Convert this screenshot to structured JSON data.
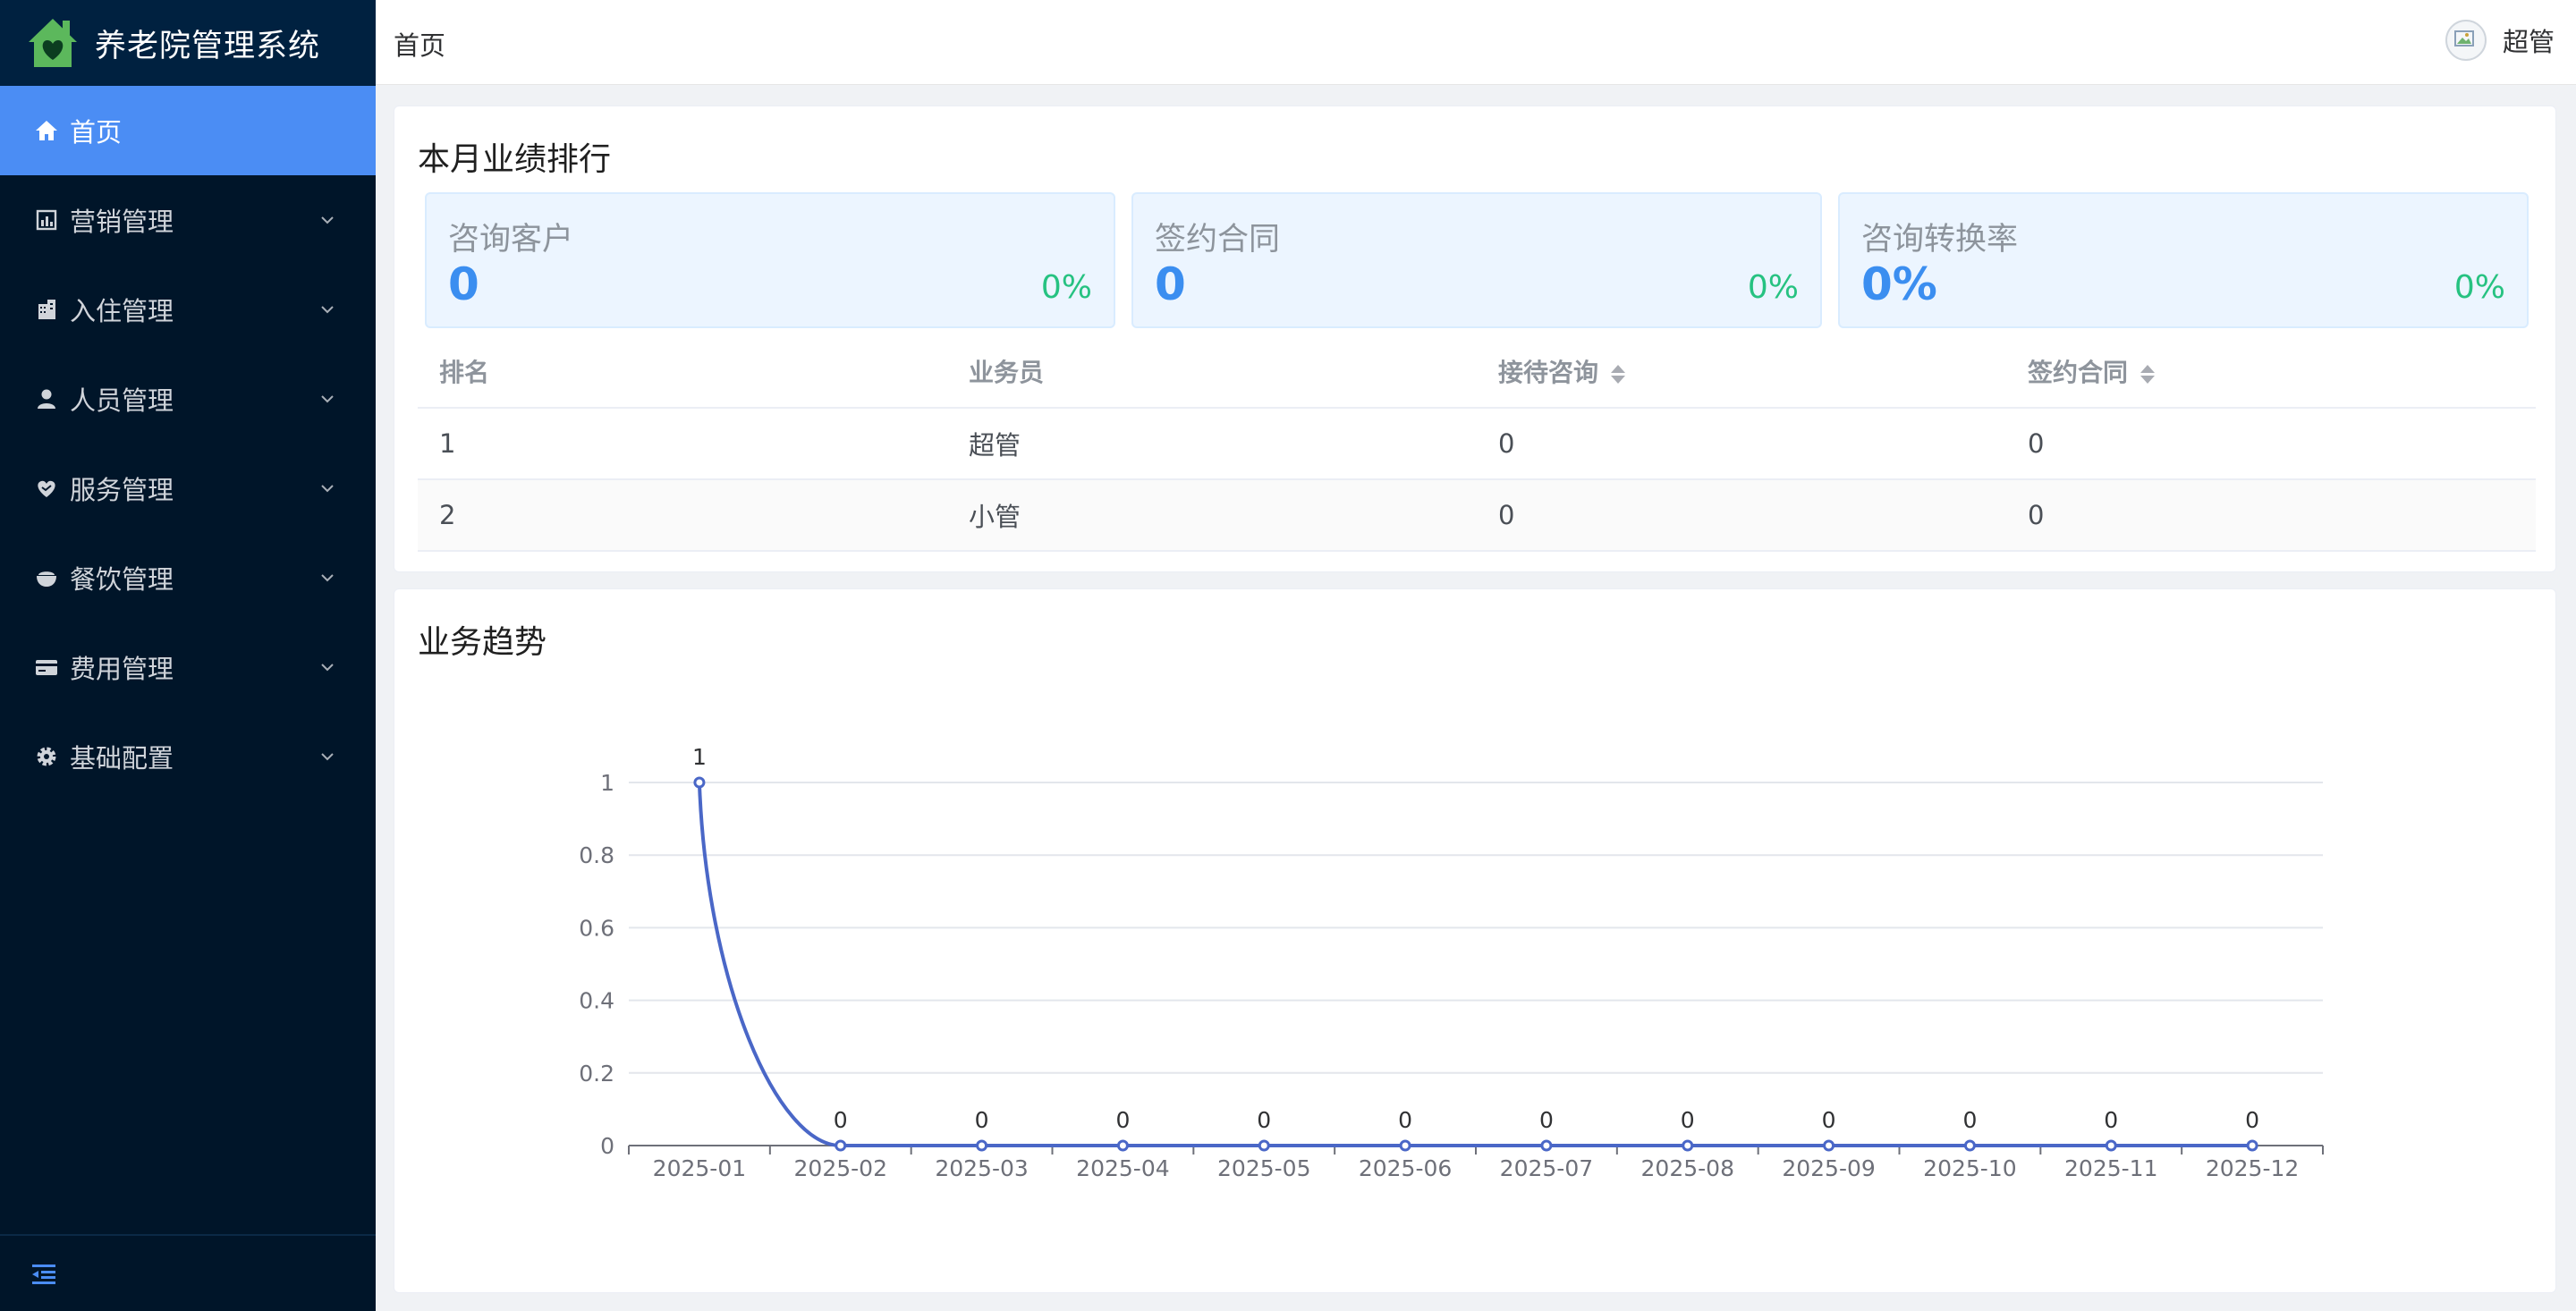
{
  "app": {
    "title": "养老院管理系统"
  },
  "sidebar": {
    "items": [
      {
        "label": "首页",
        "icon": "home-icon",
        "active": true
      },
      {
        "label": "营销管理",
        "icon": "chart-icon",
        "active": false
      },
      {
        "label": "入住管理",
        "icon": "building-icon",
        "active": false
      },
      {
        "label": "人员管理",
        "icon": "user-icon",
        "active": false
      },
      {
        "label": "服务管理",
        "icon": "heart-hand-icon",
        "active": false
      },
      {
        "label": "餐饮管理",
        "icon": "bowl-icon",
        "active": false
      },
      {
        "label": "费用管理",
        "icon": "card-icon",
        "active": false
      },
      {
        "label": "基础配置",
        "icon": "gear-icon",
        "active": false
      }
    ]
  },
  "header": {
    "breadcrumb": "首页",
    "user_name": "超管"
  },
  "ranking": {
    "title": "本月业绩排行",
    "stats": [
      {
        "label": "咨询客户",
        "value": "0",
        "pct": "0%"
      },
      {
        "label": "签约合同",
        "value": "0",
        "pct": "0%"
      },
      {
        "label": "咨询转换率",
        "value": "0%",
        "pct": "0%"
      }
    ],
    "columns": [
      "排名",
      "业务员",
      "接待咨询",
      "签约合同"
    ],
    "rows": [
      [
        "1",
        "超管",
        "0",
        "0"
      ],
      [
        "2",
        "小管",
        "0",
        "0"
      ]
    ]
  },
  "trend": {
    "title": "业务趋势"
  },
  "colors": {
    "sidebar_bg": "#001529",
    "active_menu": "#4b8df4",
    "stat_value": "#3b8ef0",
    "stat_pct": "#26c281",
    "line": "#4a67c7"
  },
  "chart_data": {
    "type": "line",
    "x": [
      "2025-01",
      "2025-02",
      "2025-03",
      "2025-04",
      "2025-05",
      "2025-06",
      "2025-07",
      "2025-08",
      "2025-09",
      "2025-10",
      "2025-11",
      "2025-12"
    ],
    "values": [
      1,
      0,
      0,
      0,
      0,
      0,
      0,
      0,
      0,
      0,
      0,
      0
    ],
    "ylim": [
      0,
      1
    ],
    "yticks": [
      "0",
      "0.2",
      "0.4",
      "0.6",
      "0.8",
      "1"
    ],
    "data_labels": true,
    "smooth": true,
    "grid": true
  }
}
